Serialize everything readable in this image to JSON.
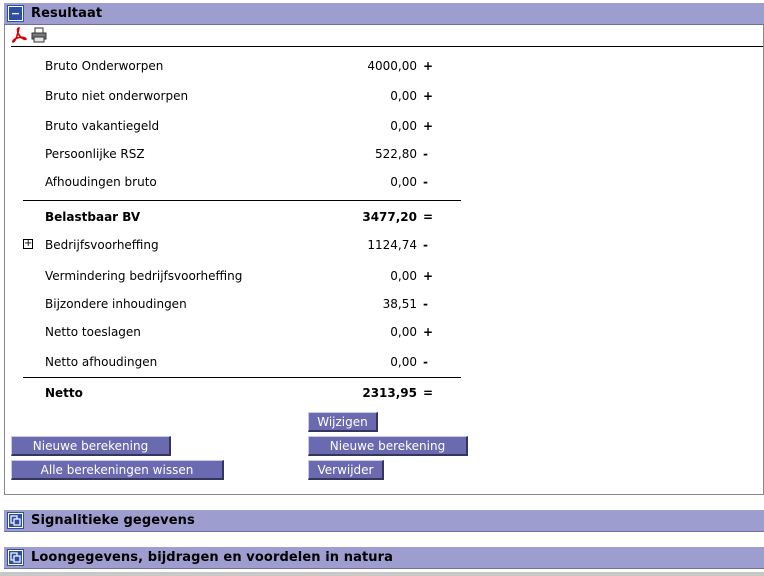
{
  "result_section": {
    "title": "Resultaat",
    "toggle_glyph": "−",
    "icons": [
      "pdf-icon",
      "print-icon"
    ]
  },
  "rows": [
    {
      "label": "Bruto Onderworpen",
      "value": "4000,00",
      "sign": "+"
    },
    {
      "label": "Bruto niet onderworpen",
      "value": "0,00",
      "sign": "+"
    },
    {
      "label": "Bruto vakantiegeld",
      "value": "0,00",
      "sign": "+"
    },
    {
      "label": "Persoonlijke RSZ",
      "value": "522,80",
      "sign": "-"
    },
    {
      "label": "Afhoudingen bruto",
      "value": "0,00",
      "sign": "-"
    },
    {
      "label": "Belastbaar BV",
      "value": "3477,20",
      "sign": "="
    },
    {
      "label": "Bedrijfsvoorheffing",
      "value": "1124,74",
      "sign": "-",
      "expand": "+"
    },
    {
      "label": "Vermindering bedrijfsvoorheffing",
      "value": "0,00",
      "sign": "+"
    },
    {
      "label": "Bijzondere inhoudingen",
      "value": "38,51",
      "sign": "-"
    },
    {
      "label": "Netto toeslagen",
      "value": "0,00",
      "sign": "+"
    },
    {
      "label": "Netto afhoudingen",
      "value": "0,00",
      "sign": "-"
    },
    {
      "label": "Netto",
      "value": "2313,95",
      "sign": "="
    }
  ],
  "buttons": {
    "wijzigen": "Wijzigen",
    "nieuwe_berekening_left": "Nieuwe berekening",
    "nieuwe_berekening_right": "Nieuwe berekening",
    "alle_wissen": "Alle berekeningen wissen",
    "verwijder": "Verwijder"
  },
  "sections": {
    "signalitiek": {
      "title": "Signalitieke gegevens",
      "icon": "expand-section-icon"
    },
    "loongegevens": {
      "title": "Loongegevens, bijdragen en voordelen in natura",
      "icon": "expand-section-icon"
    }
  },
  "colors": {
    "section_bar": "#9d9dd0",
    "button": "#6a6ab0",
    "toggle": "#2c4ea5"
  }
}
